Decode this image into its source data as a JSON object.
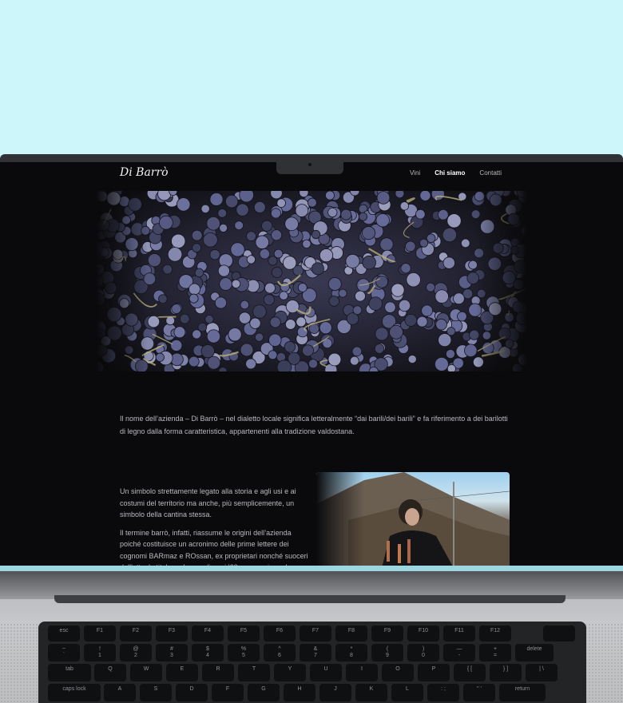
{
  "site": {
    "logo": "Di Barrò",
    "nav": [
      {
        "label": "Vini",
        "active": false
      },
      {
        "label": "Chi siamo",
        "active": true
      },
      {
        "label": "Contatti",
        "active": false
      }
    ]
  },
  "hero": {
    "alt": "grapes-photo"
  },
  "intro": "Il nome dell’azienda – Di Barrò – nel dialetto locale significa letteralmente “dai barili/dei barili” e fa riferimento a dei barilotti di legno dalla forma caratteristica, appartenenti alla tradizione valdostana.",
  "story": {
    "p1": "Un simbolo strettamente legato alla storia e agli usi e ai costumi del territorio ma anche, più semplicemente, un simbolo della cantina stessa.",
    "p2": "Il termine barrò, infatti, riassume le origini dell’azienda poiché costituisce un acronimo delle prime lettere dei cognomi BARmaz e ROssan, ex proprietari nonché suoceri dell’attuale titolare che, negli anni ’60, proseguirono la"
  },
  "keyboard": {
    "fn_row": [
      "esc",
      "F1",
      "F2",
      "F3",
      "F4",
      "F5",
      "F6",
      "F7",
      "F8",
      "F9",
      "F10",
      "F11",
      "F12"
    ],
    "num_row": [
      [
        "~",
        "`"
      ],
      [
        "!",
        "1"
      ],
      [
        "@",
        "2"
      ],
      [
        "#",
        "3"
      ],
      [
        "$",
        "4"
      ],
      [
        "%",
        "5"
      ],
      [
        "^",
        "6"
      ],
      [
        "&",
        "7"
      ],
      [
        "*",
        "8"
      ],
      [
        "(",
        "9"
      ],
      [
        ")",
        "0"
      ],
      [
        "—",
        "-"
      ],
      [
        "+",
        "="
      ],
      [
        "",
        "delete"
      ]
    ],
    "q_row": [
      "tab",
      "Q",
      "W",
      "E",
      "R",
      "T",
      "Y",
      "U",
      "I",
      "O",
      "P",
      "{ [",
      "} ]",
      "| \\"
    ],
    "a_row": [
      "caps lock",
      "A",
      "S",
      "D",
      "F",
      "G",
      "H",
      "J",
      "K",
      "L",
      ": ;",
      "\" '",
      "return"
    ]
  }
}
